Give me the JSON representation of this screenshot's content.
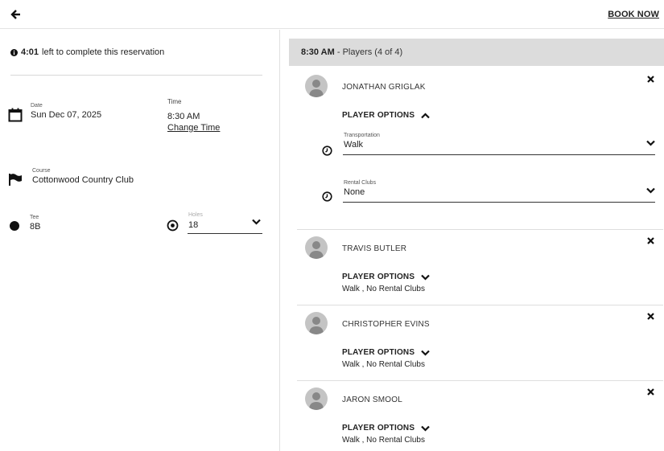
{
  "header": {
    "book_now_label": "BOOK NOW"
  },
  "reservation": {
    "timer_value": "4:01",
    "timer_suffix": "left to complete this reservation",
    "date_label": "Date",
    "date_value": "Sun Dec 07, 2025",
    "time_label": "Time",
    "time_value": "8:30 AM",
    "change_time_label": "Change Time",
    "course_label": "Course",
    "course_value": "Cottonwood Country Club",
    "tee_label": "Tee",
    "tee_value": "8B",
    "holes_label": "Holes",
    "holes_value": "18"
  },
  "panel": {
    "time": "8:30 AM",
    "subtitle": "- Players (4 of 4)"
  },
  "player_options_label": "PLAYER OPTIONS",
  "players": [
    {
      "name": "JONATHAN GRIGLAK",
      "expanded": true,
      "transportation_label": "Transportation",
      "transportation_value": "Walk",
      "rental_clubs_label": "Rental Clubs",
      "rental_clubs_value": "None"
    },
    {
      "name": "TRAVIS BUTLER",
      "expanded": false,
      "summary": "Walk , No Rental Clubs"
    },
    {
      "name": "CHRISTOPHER EVINS",
      "expanded": false,
      "summary": "Walk , No Rental Clubs"
    },
    {
      "name": "JARON SMOOL",
      "expanded": false,
      "summary": "Walk , No Rental Clubs"
    }
  ],
  "colors": {
    "panel_header_bg": "#dcdcdc",
    "avatar": "#c4c4c4",
    "text": "#222222"
  }
}
